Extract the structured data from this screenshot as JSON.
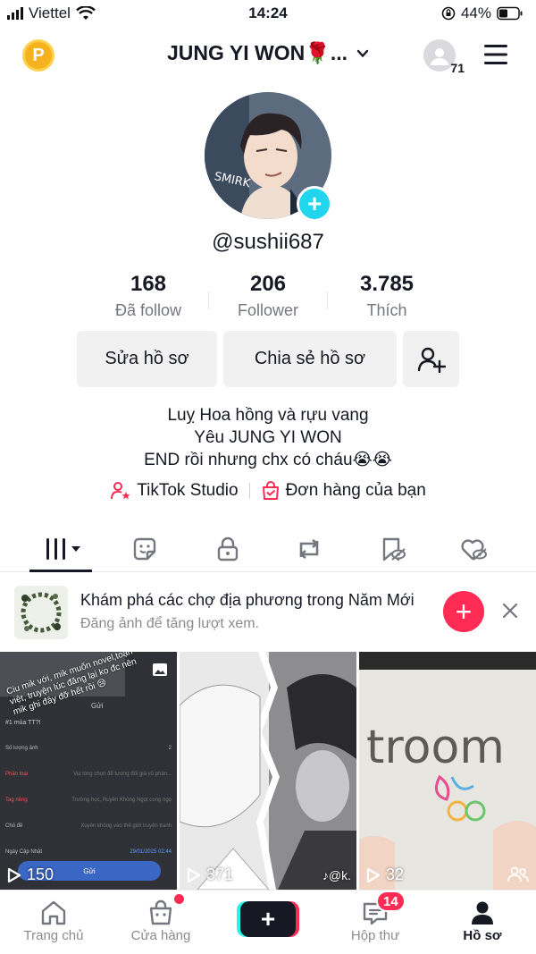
{
  "status_bar": {
    "carrier": "Viettel",
    "time": "14:24",
    "battery": "44%"
  },
  "header": {
    "title": "JUNG YI WON🌹...",
    "avatar_count": "71"
  },
  "profile": {
    "username": "@sushii687",
    "picture_text": "SMIRK",
    "stats": [
      {
        "value": "168",
        "label": "Đã follow"
      },
      {
        "value": "206",
        "label": "Follower"
      },
      {
        "value": "3.785",
        "label": "Thích"
      }
    ],
    "buttons": {
      "edit": "Sửa hồ sơ",
      "share": "Chia sẻ hồ sơ"
    },
    "bio": [
      "Luỵ Hoa hồng và rựu vang",
      "Yêu JUNG YI WON",
      "END rồi nhưng chx có cháu😭😭"
    ],
    "links": {
      "studio": "TikTok Studio",
      "orders": "Đơn hàng của bạn"
    }
  },
  "tabs": [
    {
      "icon": "grid-icon",
      "active": true
    },
    {
      "icon": "sticker-icon"
    },
    {
      "icon": "lock-icon"
    },
    {
      "icon": "repost-icon"
    },
    {
      "icon": "bookmark-hidden-icon"
    },
    {
      "icon": "heart-hidden-icon"
    }
  ],
  "promo": {
    "title": "Khám phá các chợ địa phương trong Năm Mới",
    "subtitle": "Đăng ảnh để tăng lượt xem."
  },
  "videos": [
    {
      "views": "150",
      "overlay": "Ciu mik với, mik muốn novel,toạn việt, truyện lúc đăng lại ko đc nên mik ghi đây đỡ hết rồi 😢",
      "form": {
        "send_header": "Gửi",
        "tag": "#1 mùa TT?!",
        "rows": [
          {
            "label": "Số lượng ảnh",
            "value": "2"
          },
          {
            "label": "Phân loại",
            "value": "Vui lòng chọn để tương đối giá vỏ phân..."
          },
          {
            "label": "Tag riêng",
            "value": "Trường học, Ruyền Không Ngọt cong ngọ"
          },
          {
            "label": "Chủ đề",
            "value": "Xuyên không vào thế giới truyện tranh"
          },
          {
            "label": "Ngày Cập Nhật",
            "value": "29/01/2025 02:44"
          }
        ],
        "send_button": "Gửi"
      }
    },
    {
      "views": "371",
      "watermark": "@k."
    },
    {
      "views": "32",
      "text": "troom"
    }
  ],
  "bottom_nav": [
    {
      "label": "Trang chủ",
      "icon": "home-icon"
    },
    {
      "label": "Cửa hàng",
      "icon": "shop-icon"
    },
    {
      "label": "",
      "icon": "create-icon"
    },
    {
      "label": "Hộp thư",
      "icon": "inbox-icon",
      "badge": "14"
    },
    {
      "label": "Hồ sơ",
      "icon": "profile-icon",
      "active": true
    }
  ],
  "colors": {
    "accent": "#fe2c55",
    "cyan": "#20d5ec",
    "coin": "#f5b21d"
  }
}
